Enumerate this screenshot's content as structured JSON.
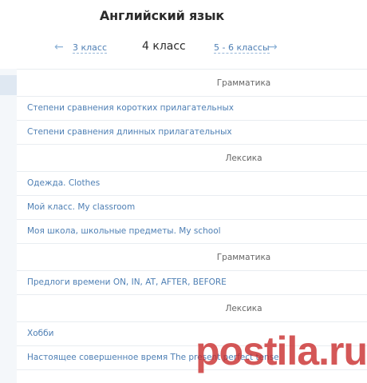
{
  "page": {
    "title": "Английский язык"
  },
  "nav": {
    "prev_label": "3 класс",
    "current_label": "4 класс",
    "next_label": "5 - 6 классы",
    "prev_icon": "arrow-left-icon",
    "next_icon": "arrow-right-icon",
    "prev_arrow": "←",
    "next_arrow": "→"
  },
  "sections": [
    {
      "header": "Грамматика",
      "items": [
        "Степени сравнения коротких прилагательных",
        "Степени сравнения длинных прилагательных"
      ]
    },
    {
      "header": "Лексика",
      "items": [
        "Одежда. Clothes",
        "Мой класс. My classroom",
        "Моя школа, школьные предметы. My school"
      ]
    },
    {
      "header": "Грамматика",
      "items": [
        "Предлоги времени ON, IN, AT, AFTER, BEFORE"
      ]
    },
    {
      "header": "Лексика",
      "items": [
        "Хобби",
        "Настоящее совершенное время The present perfect tense"
      ]
    }
  ],
  "watermark": {
    "text": "postila.ru",
    "color": "#c82828"
  },
  "colors": {
    "link": "#4e7fb4",
    "arrow": "#8bb1d6",
    "text": "#2b2b2b",
    "divider": "#e9edf1"
  }
}
